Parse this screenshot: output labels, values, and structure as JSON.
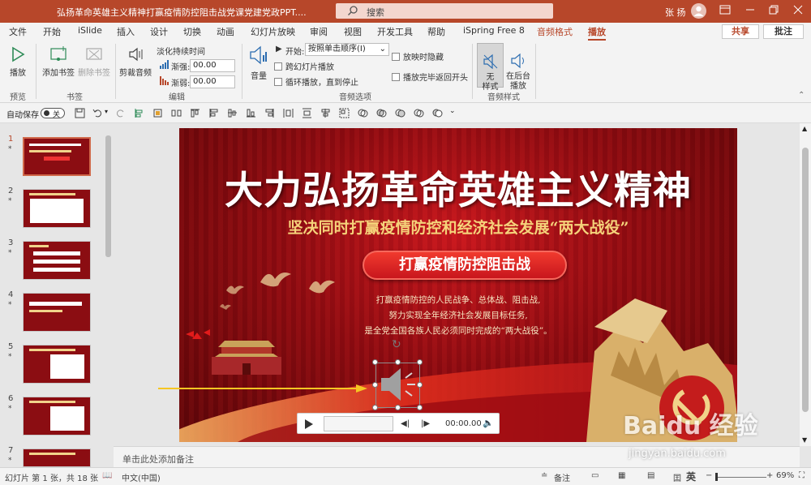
{
  "window": {
    "title": "弘扬革命英雄主义精神打赢疫情防控阻击战党课党建党政PPT....",
    "search_placeholder": "搜索",
    "user_name": "张 扬",
    "minimize_icon": "minimize-icon",
    "restore_icon": "restore-icon",
    "close_icon": "close-icon"
  },
  "ribbon_tabs": [
    "文件",
    "开始",
    "iSlide",
    "插入",
    "设计",
    "切换",
    "动画",
    "幻灯片放映",
    "审阅",
    "视图",
    "开发工具",
    "帮助",
    "iSpring Free 8",
    "音频格式",
    "播放"
  ],
  "active_tab": "播放",
  "share_label": "共享",
  "comments_label": "批注",
  "ribbon": {
    "preview": {
      "play_label": "播放",
      "group": "预览"
    },
    "bookmarks": {
      "add_label": "添加书签",
      "remove_label": "删除书签",
      "group": "书签"
    },
    "editing": {
      "trim_label": "剪裁音频",
      "fade_duration_label": "淡化持续时间",
      "fade_in_label": "渐强:",
      "fade_in_value": "00.00",
      "fade_out_label": "渐弱:",
      "fade_out_value": "00.00",
      "group": "编辑"
    },
    "audio_options": {
      "volume_label": "音量",
      "start_label": "开始:",
      "start_value": "按照单击顺序(I)",
      "play_across_slides": "跨幻灯片播放",
      "loop_until_stopped": "循环播放，直到停止",
      "hide_during_show": "放映时隐藏",
      "rewind_after_playing": "播放完毕返回开头",
      "group": "音频选项"
    },
    "audio_styles": {
      "no_style_label": "无\n样式",
      "play_in_bg_label": "在后台\n播放",
      "group": "音频样式"
    }
  },
  "quick_access": {
    "autosave_label": "自动保存",
    "autosave_state": "关"
  },
  "thumbnails": [
    {
      "num": "1",
      "star": "*",
      "selected": true
    },
    {
      "num": "2",
      "star": "*",
      "selected": false
    },
    {
      "num": "3",
      "star": "*",
      "selected": false
    },
    {
      "num": "4",
      "star": "*",
      "selected": false
    },
    {
      "num": "5",
      "star": "*",
      "selected": false
    },
    {
      "num": "6",
      "star": "*",
      "selected": false
    },
    {
      "num": "7",
      "star": "*",
      "selected": false
    }
  ],
  "slide": {
    "title": "大力弘扬革命英雄主义精神",
    "subtitle": "坚决同时打赢疫情防控和经济社会发展“两大战役”",
    "banner": "打赢疫情防控阻击战",
    "body_lines": [
      "打赢疫情防控的人民战争、总体战、阻击战,",
      "努力实现全年经济社会发展目标任务,",
      "是全党全国各族人民必须同时完成的“两大战役”。"
    ]
  },
  "player": {
    "time": "00:00.00"
  },
  "notes_placeholder": "单击此处添加备注",
  "status": {
    "slide_info": "幻灯片 第 1 张，共 18 张",
    "language": "中文(中国)",
    "notes_label": "备注",
    "zoom": "69%",
    "ime": "英"
  },
  "watermark": {
    "logo": "Baidu 经验",
    "url": "jingyan.baidu.com"
  },
  "colors": {
    "accent": "#b7472a",
    "slide_red": "#c8161d",
    "gold": "#f5d27a"
  }
}
